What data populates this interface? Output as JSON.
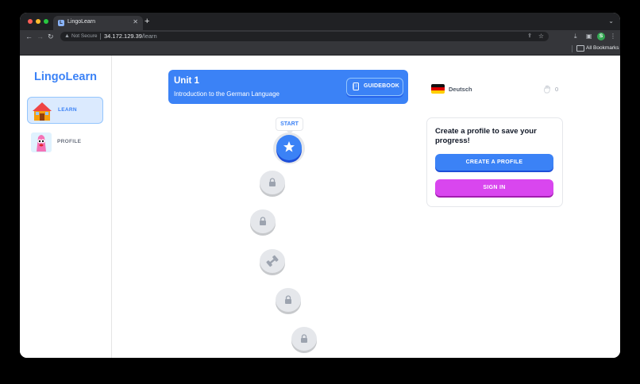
{
  "browser": {
    "tab_title": "LingoLearn",
    "tab_favicon": "L",
    "new_tab_glyph": "+",
    "close_glyph": "✕",
    "security_label": "Not Secure",
    "url_host": "34.172.129.39",
    "url_path": "/learn",
    "profile_initial": "S",
    "bookmarks_label": "All Bookmarks"
  },
  "sidebar": {
    "logo": "LingoLearn",
    "items": [
      {
        "label": "LEARN",
        "icon": "house-icon",
        "active": true
      },
      {
        "label": "PROFILE",
        "icon": "mascot-icon",
        "active": false
      }
    ]
  },
  "unit": {
    "title": "Unit 1",
    "subtitle": "Introduction to the German Language",
    "guidebook_label": "GUIDEBOOK"
  },
  "path": {
    "start_label": "START",
    "lessons": [
      {
        "state": "current",
        "icon": "star-icon"
      },
      {
        "state": "locked",
        "icon": "lock-icon"
      },
      {
        "state": "locked",
        "icon": "lock-icon"
      },
      {
        "state": "locked",
        "icon": "dumbbell-icon"
      },
      {
        "state": "locked",
        "icon": "lock-icon"
      },
      {
        "state": "locked",
        "icon": "lock-icon"
      }
    ]
  },
  "stats": {
    "language": "Deutsch",
    "hearts": "0"
  },
  "profile_card": {
    "title": "Create a profile to save your progress!",
    "create_label": "CREATE A PROFILE",
    "signin_label": "SIGN IN"
  },
  "colors": {
    "primary": "#3b82f6",
    "signin": "#d946ef"
  }
}
